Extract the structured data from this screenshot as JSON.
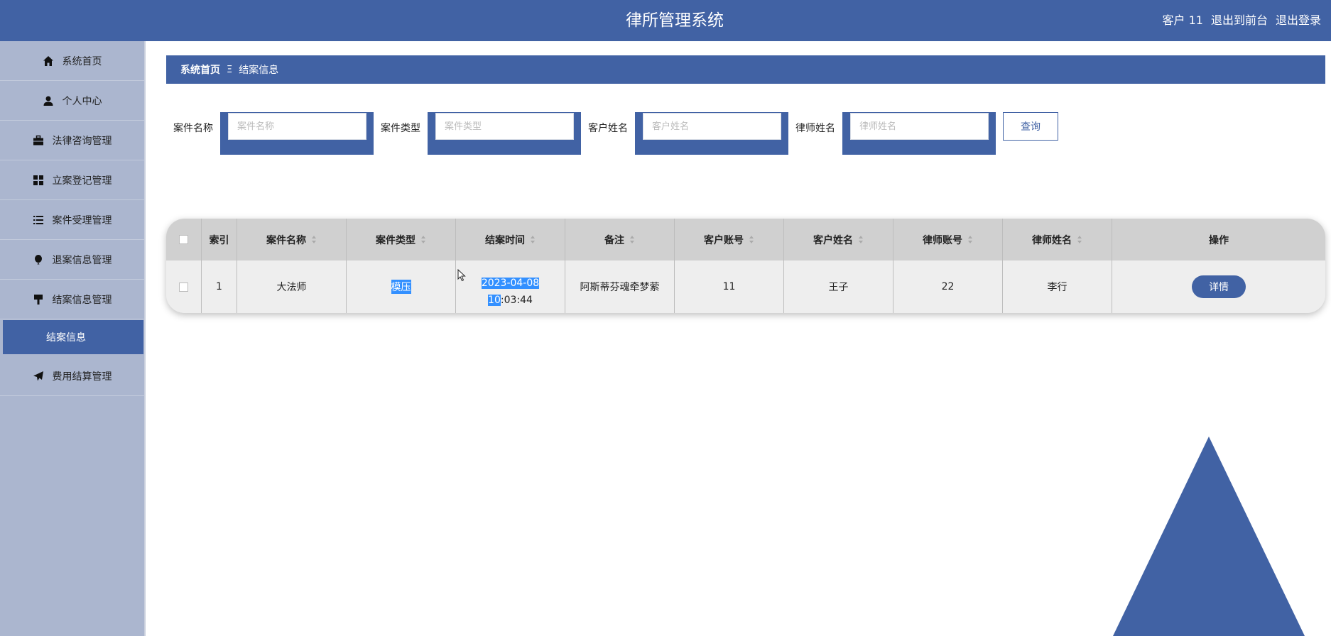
{
  "header": {
    "title": "律所管理系统",
    "user": "客户 11",
    "to_front": "退出到前台",
    "logout": "退出登录"
  },
  "sidebar": {
    "items": [
      {
        "label": "系统首页",
        "icon": "home-icon"
      },
      {
        "label": "个人中心",
        "icon": "user-icon"
      },
      {
        "label": "法律咨询管理",
        "icon": "briefcase-icon"
      },
      {
        "label": "立案登记管理",
        "icon": "grid-icon"
      },
      {
        "label": "案件受理管理",
        "icon": "list-icon"
      },
      {
        "label": "退案信息管理",
        "icon": "balloon-icon"
      },
      {
        "label": "结案信息管理",
        "icon": "stamp-icon"
      },
      {
        "label": "费用结算管理",
        "icon": "paper-plane-icon"
      }
    ],
    "active_sub": "结案信息"
  },
  "breadcrumb": {
    "home": "系统首页",
    "separator": "Ξ",
    "current": "结案信息"
  },
  "search": {
    "case_name_label": "案件名称",
    "case_name_placeholder": "案件名称",
    "case_type_label": "案件类型",
    "case_type_placeholder": "案件类型",
    "client_name_label": "客户姓名",
    "client_name_placeholder": "客户姓名",
    "lawyer_name_label": "律师姓名",
    "lawyer_name_placeholder": "律师姓名",
    "query_label": "查询"
  },
  "table": {
    "headers": [
      "索引",
      "案件名称",
      "案件类型",
      "结案时间",
      "备注",
      "客户账号",
      "客户姓名",
      "律师账号",
      "律师姓名",
      "操作"
    ],
    "rows": [
      {
        "index": "1",
        "case_name": "大法师",
        "case_type": "模压",
        "close_time_selected": "2023-04-08 10",
        "close_time_rest": ":03:44",
        "remark": "阿斯蒂芬魂牵梦萦",
        "client_account": "11",
        "client_name": "王子",
        "lawyer_account": "22",
        "lawyer_name": "李行",
        "action": "详情"
      }
    ]
  },
  "colors": {
    "primary": "#4162a4",
    "sidebar_bg": "#abb6cf",
    "selection": "#3390ff"
  }
}
